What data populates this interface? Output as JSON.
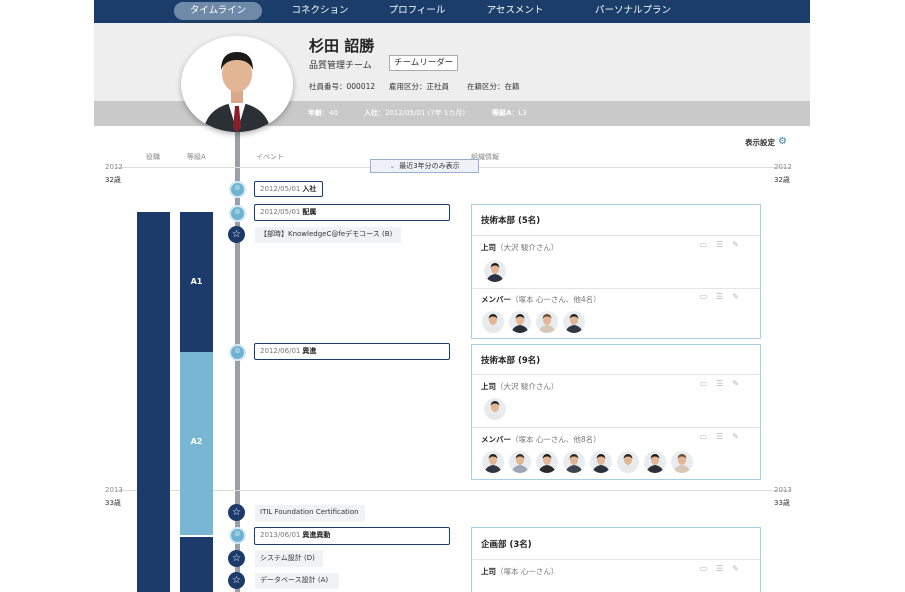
{
  "nav": {
    "items": [
      {
        "label": "タイムライン"
      },
      {
        "label": "コネクション"
      },
      {
        "label": "プロフィール"
      },
      {
        "label": "アセスメント"
      },
      {
        "label": "パーソナルプラン"
      }
    ],
    "active_index": 0
  },
  "profile": {
    "name": "杉田 詔勝",
    "team": "品質管理チーム",
    "role_badge": "チームリーダー",
    "employee_no": "社員番号：000012",
    "employment_type": "雇用区分：正社員",
    "status": "在籍区分：在籍"
  },
  "stats": {
    "age_label": "年齢",
    "age_value": "：40",
    "joined_label": "入社",
    "joined_value": "：2012/05/01 (7年 1カ月)",
    "grade_label": "等級A",
    "grade_value": "：L3"
  },
  "timeline": {
    "settings_label": "表示設定",
    "columns": [
      "役職",
      "等級A",
      "イベント",
      "組織情報"
    ],
    "recent_button": "最近3年分のみ表示",
    "years": [
      {
        "year": "2012",
        "age": "32歳"
      },
      {
        "year": "2013",
        "age": "33歳"
      }
    ],
    "grade_bars": [
      {
        "label": "A1"
      },
      {
        "label": "A2"
      }
    ],
    "events": [
      {
        "date": "2012/05/01",
        "title": "入社",
        "kind": "pin"
      },
      {
        "date": "2012/05/01",
        "title": "配属",
        "kind": "pin"
      },
      {
        "date": "",
        "title": "【部時】KnowledgeC@feデモコース (B)",
        "kind": "star"
      },
      {
        "date": "2012/06/01",
        "title": "異進",
        "kind": "pin"
      },
      {
        "date": "",
        "title": "ITIL Foundation Certification",
        "kind": "star"
      },
      {
        "date": "2013/06/01",
        "title": "異進異動",
        "kind": "pin"
      },
      {
        "date": "",
        "title": "システム設計 (D)",
        "kind": "star"
      },
      {
        "date": "",
        "title": "データベース設計 (A)",
        "kind": "star"
      }
    ]
  },
  "org_cards": [
    {
      "title": "技術本部 (5名)",
      "boss_label": "上司",
      "boss_names": "（大沢 駿介さん）",
      "members_label": "メンバー",
      "members_names": "（塚本 心一さん、他4名）",
      "member_count": 4
    },
    {
      "title": "技術本部 (9名)",
      "boss_label": "上司",
      "boss_names": "（大沢 駿介さん）",
      "members_label": "メンバー",
      "members_names": "（塚本 心一さん、他8名）",
      "member_count": 8
    },
    {
      "title": "企画部 (3名)",
      "boss_label": "上司",
      "boss_names": "（塚本 心一さん）",
      "members_label": "",
      "members_names": "",
      "member_count": 0
    }
  ],
  "colors": {
    "nav_bg": "#1a3d6a",
    "dark_navy": "#1c3b6b",
    "light_blue": "#78b6d3",
    "pin_blue": "#6fb3d2"
  }
}
